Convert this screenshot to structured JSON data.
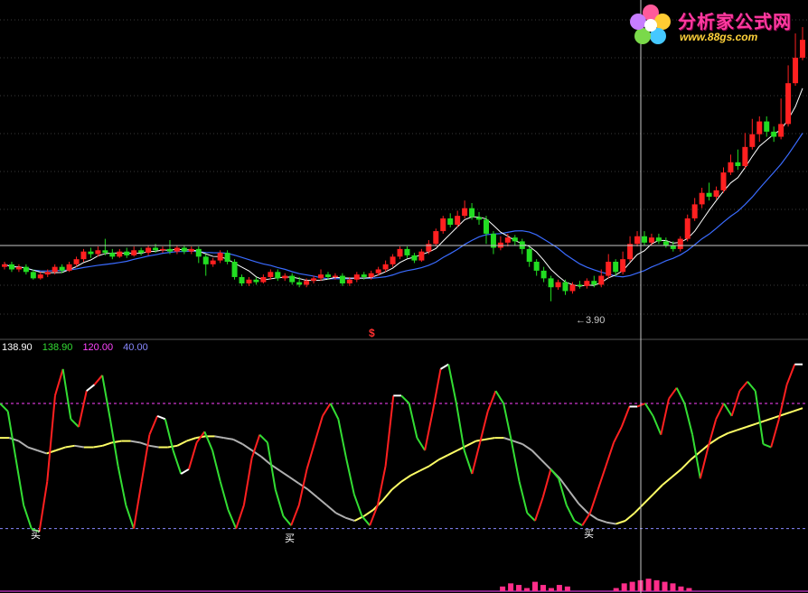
{
  "logo": {
    "title": "分析家公式网",
    "url": "www.88gs.com"
  },
  "price_panel": {
    "low_label": "3.90",
    "marker": "$"
  },
  "indicator_panel": {
    "legend": [
      {
        "text": "138.90",
        "color": "#ffffff"
      },
      {
        "text": "138.90",
        "color": "#33dd33"
      },
      {
        "text": "120.00",
        "color": "#ff44ff"
      },
      {
        "text": "40.00",
        "color": "#8888ff"
      }
    ],
    "buy_labels": [
      "买",
      "买",
      "买"
    ]
  },
  "colors": {
    "up": "#ff2020",
    "down": "#22dd22",
    "ma_short": "#ffffff",
    "ma_long": "#3a6bff",
    "osc_rise": "#ff2020",
    "osc_fall": "#33dd33",
    "signal": "#ffff66",
    "upper_line": "#ff44ff",
    "lower_line": "#8888ff",
    "volume": "#ff2d8a"
  },
  "chart_data": [
    {
      "type": "candlestick",
      "title": "",
      "ylim": [
        3.7,
        6.0
      ],
      "candles": [
        [
          4.12,
          4.14,
          4.16,
          4.1
        ],
        [
          4.14,
          4.1,
          4.16,
          4.08
        ],
        [
          4.1,
          4.12,
          4.14,
          4.08
        ],
        [
          4.12,
          4.08,
          4.14,
          4.06
        ],
        [
          4.08,
          4.03,
          4.1,
          4.02
        ],
        [
          4.03,
          4.06,
          4.08,
          4.02
        ],
        [
          4.06,
          4.08,
          4.1,
          4.04
        ],
        [
          4.08,
          4.12,
          4.14,
          4.06
        ],
        [
          4.12,
          4.09,
          4.14,
          4.07
        ],
        [
          4.09,
          4.14,
          4.16,
          4.08
        ],
        [
          4.14,
          4.18,
          4.2,
          4.12
        ],
        [
          4.18,
          4.24,
          4.26,
          4.16
        ],
        [
          4.24,
          4.22,
          4.27,
          4.19
        ],
        [
          4.22,
          4.25,
          4.28,
          4.2
        ],
        [
          4.25,
          4.23,
          4.34,
          4.21
        ],
        [
          4.23,
          4.2,
          4.26,
          4.18
        ],
        [
          4.2,
          4.24,
          4.26,
          4.19
        ],
        [
          4.24,
          4.21,
          4.27,
          4.19
        ],
        [
          4.21,
          4.25,
          4.28,
          4.2
        ],
        [
          4.25,
          4.23,
          4.27,
          4.21
        ],
        [
          4.23,
          4.27,
          4.29,
          4.21
        ],
        [
          4.27,
          4.25,
          4.3,
          4.23
        ],
        [
          4.25,
          4.26,
          4.28,
          4.23
        ],
        [
          4.26,
          4.24,
          4.33,
          4.22
        ],
        [
          4.24,
          4.27,
          4.29,
          4.22
        ],
        [
          4.27,
          4.24,
          4.29,
          4.22
        ],
        [
          4.24,
          4.26,
          4.28,
          4.22
        ],
        [
          4.26,
          4.2,
          4.28,
          4.15
        ],
        [
          4.2,
          4.14,
          4.22,
          4.05
        ],
        [
          4.14,
          4.17,
          4.19,
          4.12
        ],
        [
          4.17,
          4.23,
          4.25,
          4.15
        ],
        [
          4.23,
          4.16,
          4.25,
          4.14
        ],
        [
          4.16,
          4.04,
          4.18,
          4.02
        ],
        [
          4.04,
          3.99,
          4.06,
          3.97
        ],
        [
          3.99,
          4.02,
          4.04,
          3.97
        ],
        [
          4.02,
          4.0,
          4.04,
          3.98
        ],
        [
          4.0,
          4.04,
          4.06,
          3.99
        ],
        [
          4.04,
          4.08,
          4.1,
          4.02
        ],
        [
          4.08,
          4.03,
          4.1,
          4.01
        ],
        [
          4.03,
          4.05,
          4.07,
          4.01
        ],
        [
          4.05,
          4.0,
          4.07,
          3.98
        ],
        [
          4.0,
          3.98,
          4.04,
          3.96
        ],
        [
          3.98,
          4.01,
          4.03,
          3.96
        ],
        [
          4.01,
          4.03,
          4.05,
          3.99
        ],
        [
          4.03,
          4.06,
          4.1,
          4.01
        ],
        [
          4.06,
          4.04,
          4.08,
          4.02
        ],
        [
          4.04,
          4.05,
          4.07,
          4.02
        ],
        [
          4.05,
          3.99,
          4.07,
          3.97
        ],
        [
          3.99,
          4.02,
          4.04,
          3.97
        ],
        [
          4.02,
          4.06,
          4.08,
          4.0
        ],
        [
          4.06,
          4.04,
          4.08,
          4.02
        ],
        [
          4.04,
          4.07,
          4.09,
          4.02
        ],
        [
          4.07,
          4.1,
          4.12,
          4.05
        ],
        [
          4.1,
          4.14,
          4.17,
          4.08
        ],
        [
          4.14,
          4.2,
          4.22,
          4.12
        ],
        [
          4.2,
          4.26,
          4.28,
          4.18
        ],
        [
          4.26,
          4.21,
          4.28,
          4.19
        ],
        [
          4.21,
          4.17,
          4.23,
          4.15
        ],
        [
          4.17,
          4.24,
          4.26,
          4.16
        ],
        [
          4.24,
          4.3,
          4.33,
          4.22
        ],
        [
          4.3,
          4.4,
          4.42,
          4.28
        ],
        [
          4.4,
          4.5,
          4.52,
          4.38
        ],
        [
          4.5,
          4.45,
          4.54,
          4.43
        ],
        [
          4.45,
          4.52,
          4.56,
          4.43
        ],
        [
          4.52,
          4.58,
          4.64,
          4.5
        ],
        [
          4.58,
          4.51,
          4.62,
          4.49
        ],
        [
          4.51,
          4.49,
          4.55,
          4.45
        ],
        [
          4.49,
          4.38,
          4.52,
          4.3
        ],
        [
          4.38,
          4.27,
          4.4,
          4.22
        ],
        [
          4.27,
          4.31,
          4.36,
          4.25
        ],
        [
          4.31,
          4.35,
          4.38,
          4.28
        ],
        [
          4.35,
          4.32,
          4.37,
          4.29
        ],
        [
          4.32,
          4.26,
          4.34,
          4.22
        ],
        [
          4.26,
          4.16,
          4.28,
          4.12
        ],
        [
          4.16,
          4.09,
          4.18,
          4.05
        ],
        [
          4.09,
          4.03,
          4.12,
          4.0
        ],
        [
          4.03,
          3.96,
          4.05,
          3.85
        ],
        [
          3.96,
          4.0,
          4.02,
          3.94
        ],
        [
          4.0,
          3.93,
          4.02,
          3.9
        ],
        [
          3.93,
          3.98,
          4.0,
          3.91
        ],
        [
          3.98,
          3.97,
          4.01,
          3.95
        ],
        [
          3.97,
          4.01,
          4.03,
          3.95
        ],
        [
          4.01,
          3.98,
          4.05,
          3.96
        ],
        [
          3.98,
          4.05,
          4.1,
          3.96
        ],
        [
          4.05,
          4.16,
          4.22,
          4.03
        ],
        [
          4.16,
          4.08,
          4.18,
          4.05
        ],
        [
          4.08,
          4.18,
          4.24,
          4.06
        ],
        [
          4.18,
          4.3,
          4.36,
          4.16
        ],
        [
          4.3,
          4.36,
          4.4,
          4.28
        ],
        [
          4.36,
          4.31,
          4.4,
          4.29
        ],
        [
          4.31,
          4.35,
          4.38,
          4.29
        ],
        [
          4.35,
          4.32,
          4.38,
          4.3
        ],
        [
          4.32,
          4.29,
          4.35,
          4.27
        ],
        [
          4.29,
          4.26,
          4.32,
          4.24
        ],
        [
          4.26,
          4.34,
          4.36,
          4.24
        ],
        [
          4.34,
          4.5,
          4.53,
          4.32
        ],
        [
          4.5,
          4.61,
          4.66,
          4.48
        ],
        [
          4.61,
          4.7,
          4.74,
          4.58
        ],
        [
          4.7,
          4.67,
          4.78,
          4.64
        ],
        [
          4.67,
          4.72,
          4.75,
          4.65
        ],
        [
          4.72,
          4.86,
          4.9,
          4.7
        ],
        [
          4.86,
          4.94,
          5.0,
          4.84
        ],
        [
          4.94,
          4.91,
          5.04,
          4.88
        ],
        [
          4.91,
          5.06,
          5.17,
          4.89
        ],
        [
          5.06,
          5.16,
          5.28,
          5.04
        ],
        [
          5.16,
          5.26,
          5.3,
          5.1
        ],
        [
          5.26,
          5.18,
          5.3,
          5.14
        ],
        [
          5.18,
          5.14,
          5.22,
          5.1
        ],
        [
          5.14,
          5.24,
          5.44,
          5.12
        ],
        [
          5.24,
          5.56,
          5.7,
          5.22
        ],
        [
          5.56,
          5.76,
          5.95,
          5.54
        ],
        [
          5.76,
          5.9,
          6.0,
          5.74
        ]
      ],
      "low_marker": 3.9
    },
    {
      "type": "line",
      "title": "",
      "ylim": [
        0,
        150
      ],
      "upper_level": 120.0,
      "lower_level": 40.0,
      "value": 138.9,
      "series": [
        {
          "values": [
            120,
            115,
            85,
            55,
            40,
            38,
            70,
            125,
            142,
            110,
            105,
            128,
            132,
            138,
            110,
            80,
            55,
            40,
            70,
            100,
            112,
            110,
            90,
            75,
            78,
            95,
            102,
            90,
            70,
            52,
            40,
            55,
            85,
            100,
            95,
            65,
            48,
            42,
            55,
            78,
            95,
            112,
            120,
            110,
            85,
            62,
            48,
            42,
            55,
            80,
            125,
            125,
            120,
            98,
            90,
            115,
            142,
            145,
            120,
            90,
            75,
            95,
            115,
            128,
            120,
            96,
            70,
            50,
            45,
            60,
            78,
            72,
            55,
            45,
            42,
            50,
            65,
            80,
            95,
            105,
            118,
            118,
            120,
            112,
            100,
            123,
            130,
            120,
            100,
            72,
            92,
            110,
            120,
            112,
            128,
            134,
            128,
            94,
            92,
            110,
            132,
            145,
            145
          ]
        },
        {
          "values": [
            98,
            98,
            96,
            92,
            90,
            88,
            90,
            92,
            93,
            92,
            92,
            93,
            95,
            96,
            96,
            95,
            93,
            92,
            92,
            93,
            96,
            98,
            99,
            99,
            98,
            97,
            94,
            90,
            86,
            81,
            77,
            73,
            69,
            65,
            60,
            55,
            50,
            47,
            45,
            48,
            52,
            58,
            65,
            70,
            74,
            77,
            80,
            84,
            87,
            90,
            93,
            96,
            97,
            98,
            98,
            96,
            94,
            90,
            84,
            78,
            72,
            64,
            56,
            50,
            46,
            44,
            43,
            45,
            50,
            56,
            62,
            68,
            73,
            78,
            84,
            89,
            94,
            98,
            101,
            103,
            105,
            107,
            109,
            111,
            113,
            115,
            117
          ]
        },
        {
          "values": [
            0,
            0,
            0,
            0,
            0,
            0,
            0,
            0,
            0,
            0,
            0,
            0,
            0,
            0,
            0,
            0,
            0,
            0,
            0,
            0,
            0,
            0,
            0,
            0,
            0,
            0,
            0,
            0,
            0,
            0,
            0,
            0,
            0,
            0,
            0,
            0,
            0,
            0,
            0,
            0,
            0,
            0,
            0,
            0,
            0,
            0,
            0,
            0,
            0,
            0,
            0,
            0,
            0,
            0,
            0,
            0,
            0,
            0,
            0,
            0,
            0,
            0,
            3,
            5,
            4,
            2,
            6,
            4,
            2,
            4,
            3,
            0,
            0,
            0,
            0,
            0,
            2,
            5,
            6,
            7,
            8,
            7,
            6,
            5,
            3,
            2,
            0,
            0,
            0,
            0,
            0,
            0,
            0,
            0,
            0,
            0,
            0,
            0,
            0,
            0
          ]
        }
      ]
    }
  ]
}
